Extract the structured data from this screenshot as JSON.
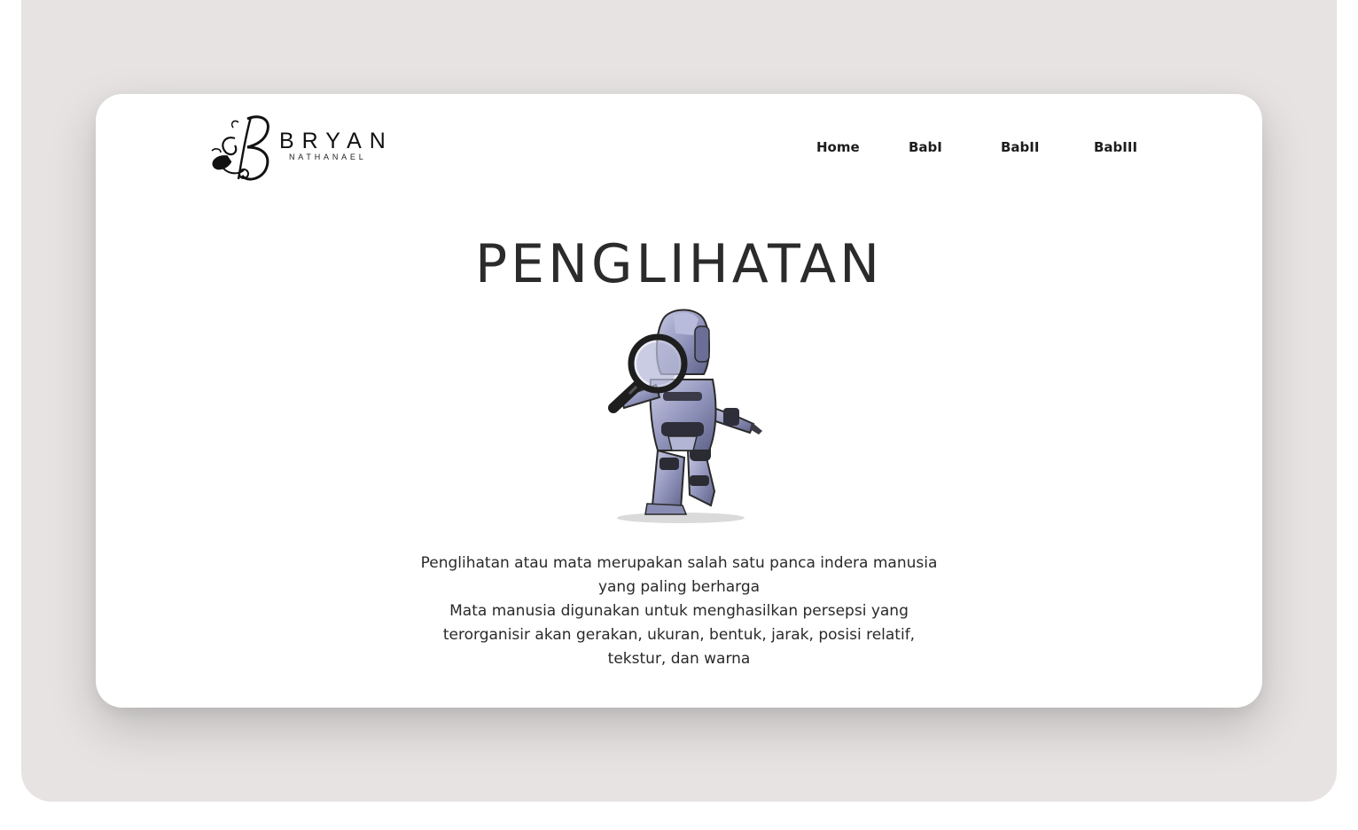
{
  "logo": {
    "first_name": "BRYAN",
    "last_name": "NATHANAEL"
  },
  "nav": {
    "items": [
      {
        "label": "Home"
      },
      {
        "label": "BabI"
      },
      {
        "label": "BabII"
      },
      {
        "label": "BabIII"
      }
    ]
  },
  "hero": {
    "title": "PENGLIHATAN",
    "image_icon": "robot-with-magnifying-glass"
  },
  "description": {
    "paragraph_1": "Penglihatan atau mata merupakan salah satu panca indera manusia yang paling berharga",
    "paragraph_2": "Mata manusia digunakan untuk menghasilkan persepsi yang terorganisir akan gerakan, ukuran, bentuk, jarak, posisi relatif, tekstur, dan warna"
  },
  "colors": {
    "backdrop": "#e6e3e2",
    "card": "#ffffff",
    "text": "#2b2b2b"
  }
}
